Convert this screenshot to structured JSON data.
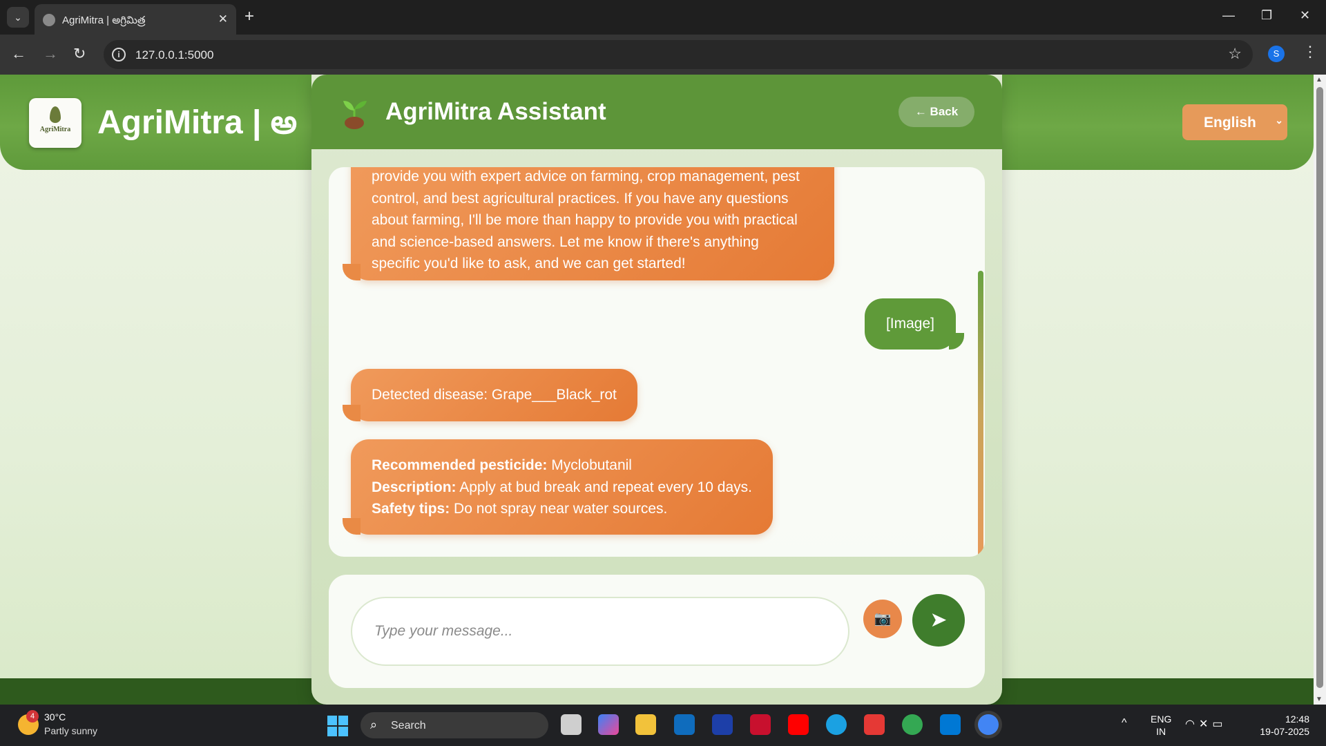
{
  "browser": {
    "tab_title": "AgriMitra | అగ్రిమిత్ర",
    "url": "127.0.0.1:5000",
    "profile_initial": "S"
  },
  "site": {
    "title": "AgriMitra | అ",
    "logo_text": "AgriMitra",
    "language": "English"
  },
  "assistant": {
    "title": "AgriMitra Assistant",
    "back_label": "← Back",
    "messages": [
      {
        "role": "bot",
        "lines": [
          "provide you with expert advice on farming, crop management, pest",
          "control, and best agricultural practices. If you have any questions",
          "about farming, I'll be more than happy to provide you with practical",
          "and science-based answers. Let me know if there's anything",
          "specific you'd like to ask, and we can get started!"
        ]
      },
      {
        "role": "user",
        "text": "[Image]"
      },
      {
        "role": "bot",
        "text": "Detected disease: Grape___Black_rot"
      },
      {
        "role": "bot",
        "rows": [
          {
            "label": "Recommended pesticide:",
            "value": " Myclobutanil"
          },
          {
            "label": "Description:",
            "value": " Apply at bud break and repeat every 10 days."
          },
          {
            "label": "Safety tips:",
            "value": " Do not spray near water sources."
          }
        ]
      }
    ],
    "input_placeholder": "Type your message...",
    "camera_icon": "camera-icon",
    "send_icon": "send-arrow-icon"
  },
  "taskbar": {
    "badge_count": "4",
    "temperature": "30°C",
    "weather": "Partly sunny",
    "search_label": "Search",
    "lang_top": "ENG",
    "lang_bottom": "IN",
    "time": "12:48",
    "date": "19-07-2025"
  },
  "colors": {
    "header_green": "#5d9539",
    "bot_orange": "#e57a35",
    "user_green": "#5f9a39",
    "send_green": "#3f7d2c"
  }
}
